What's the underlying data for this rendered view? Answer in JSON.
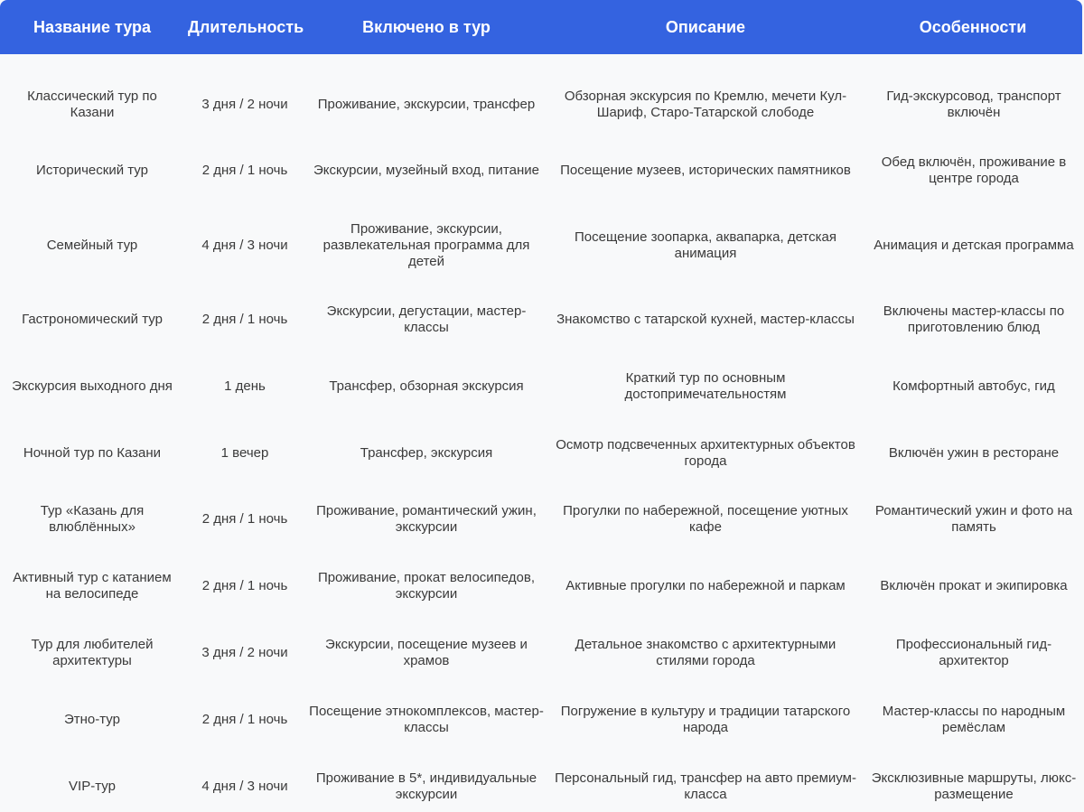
{
  "columns": [
    "Название тура",
    "Длительность",
    "Включено в тур",
    "Описание",
    "Особенности"
  ],
  "rows": [
    [
      "Классический тур по Казани",
      "3 дня / 2 ночи",
      "Проживание, экскурсии, трансфер",
      "Обзорная экскурсия по Кремлю, мечети Кул-Шариф, Старо-Татарской слободе",
      "Гид-экскурсовод, транспорт включён"
    ],
    [
      "Исторический тур",
      "2 дня / 1 ночь",
      "Экскурсии, музейный вход, питание",
      "Посещение музеев, исторических памятников",
      "Обед включён, проживание в центре города"
    ],
    [
      "Семейный тур",
      "4 дня / 3 ночи",
      "Проживание, экскурсии, развлекательная программа для детей",
      "Посещение зоопарка, аквапарка, детская анимация",
      "Анимация и детская программа"
    ],
    [
      "Гастрономический тур",
      "2 дня / 1 ночь",
      "Экскурсии, дегустации, мастер-классы",
      "Знакомство с татарской кухней, мастер-классы",
      "Включены мастер-классы по приготовлению блюд"
    ],
    [
      "Экскурсия выходного дня",
      "1 день",
      "Трансфер, обзорная экскурсия",
      "Краткий тур по основным достопримечательностям",
      "Комфортный автобус, гид"
    ],
    [
      "Ночной тур по Казани",
      "1 вечер",
      "Трансфер, экскурсия",
      "Осмотр подсвеченных архитектурных объектов города",
      "Включён ужин в ресторане"
    ],
    [
      "Тур «Казань для влюблённых»",
      "2 дня / 1 ночь",
      "Проживание, романтический ужин, экскурсии",
      "Прогулки по набережной, посещение уютных кафе",
      "Романтический ужин и фото на память"
    ],
    [
      "Активный тур с катанием на велосипеде",
      "2 дня / 1 ночь",
      "Проживание, прокат велосипедов, экскурсии",
      "Активные прогулки по набережной и паркам",
      "Включён прокат и экипировка"
    ],
    [
      "Тур для любителей архитектуры",
      "3 дня / 2 ночи",
      "Экскурсии, посещение музеев и храмов",
      "Детальное знакомство с архитектурными стилями города",
      "Профессиональный гид-архитектор"
    ],
    [
      "Этно-тур",
      "2 дня / 1 ночь",
      "Посещение этнокомплексов, мастер-классы",
      "Погружение в культуру и традиции татарского народа",
      "Мастер-классы по народным ремёслам"
    ],
    [
      "VIP-тур",
      "4 дня / 3 ночи",
      "Проживание в 5*, индивидуальные экскурсии",
      "Персональный гид, трансфер на авто премиум-класса",
      "Эксклюзивные маршруты, люкс-размещение"
    ]
  ]
}
